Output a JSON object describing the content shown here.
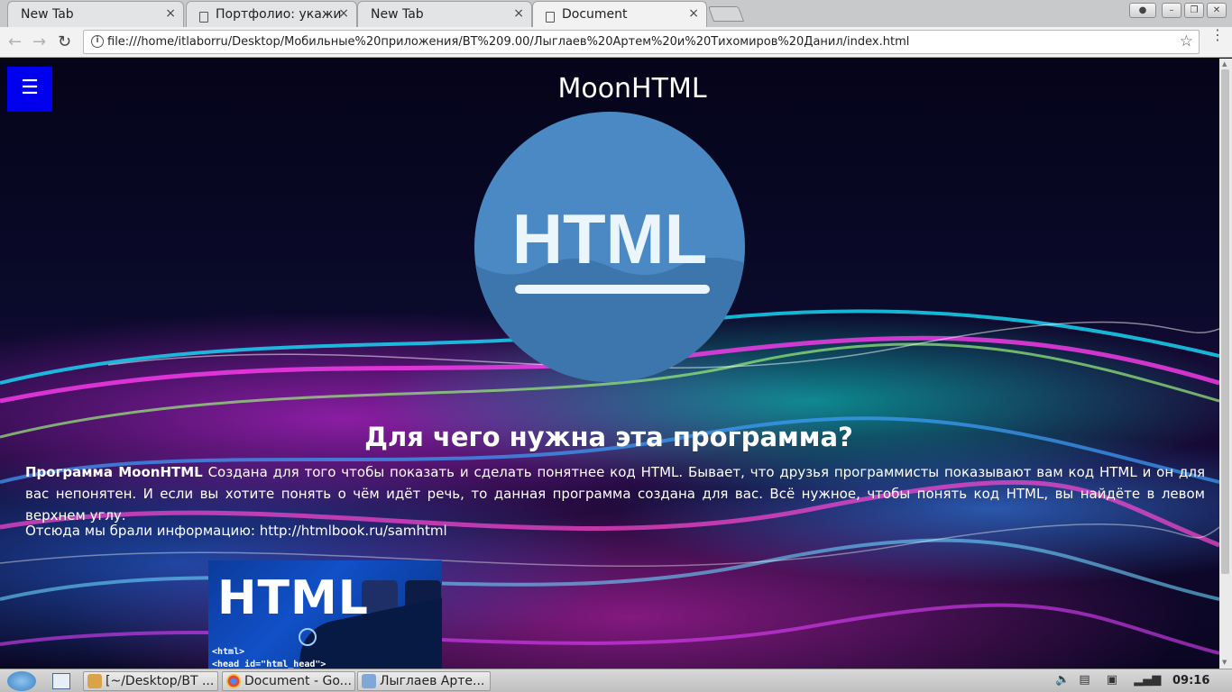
{
  "browser": {
    "tabs": [
      {
        "title": "New Tab",
        "active": false
      },
      {
        "title": "Портфолио: укажи",
        "active": false
      },
      {
        "title": "New Tab",
        "active": false
      },
      {
        "title": "Document",
        "active": true
      }
    ],
    "close_glyph": "×",
    "url": "file:///home/itlaborru/Desktop/Мобильные%20приложения/ВТ%209.00/Лыглаев%20Артем%20и%20Тихомиров%20Данил/index.html",
    "icons": {
      "back": "←",
      "forward": "→",
      "reload": "↻",
      "star": "☆",
      "menu": "⋮",
      "info": "i"
    }
  },
  "page": {
    "menu_glyph": "☰",
    "site_title": "MoonHTML",
    "logo_text": "HTML",
    "headline": "Для чего нужна эта программа?",
    "paragraph_bold": "Программа MoonHTML",
    "paragraph_rest": " Создана для того чтобы показать и сделать понятнее код HTML. Бывает, что друзья программисты показывают вам код HTML и он для вас непонятен. И если вы хотите понять о чём идёт речь, то данная программа создана для вас. Всё нужное, чтобы понять код HTML, вы найдёте в левом верхнем углу.",
    "source_line": "Отсюда мы брали информацию: http://htmlbook.ru/samhtml",
    "photo": {
      "big": "HTML",
      "code1": "<html>",
      "code2": "<head id=\"html_head\">"
    }
  },
  "taskbar": {
    "items": [
      {
        "label": "[~/Desktop/ВТ ...",
        "icon": "terminal-icon"
      },
      {
        "label": "Document - Go...",
        "icon": "chrome-icon"
      },
      {
        "label": "Лыглаев Арте...",
        "icon": "folder-icon"
      }
    ],
    "clock": "09:16"
  },
  "colors": {
    "menu_button": "#0000ee",
    "logo_circle": "#4a89c3",
    "logo_text": "#eaf6fb"
  }
}
